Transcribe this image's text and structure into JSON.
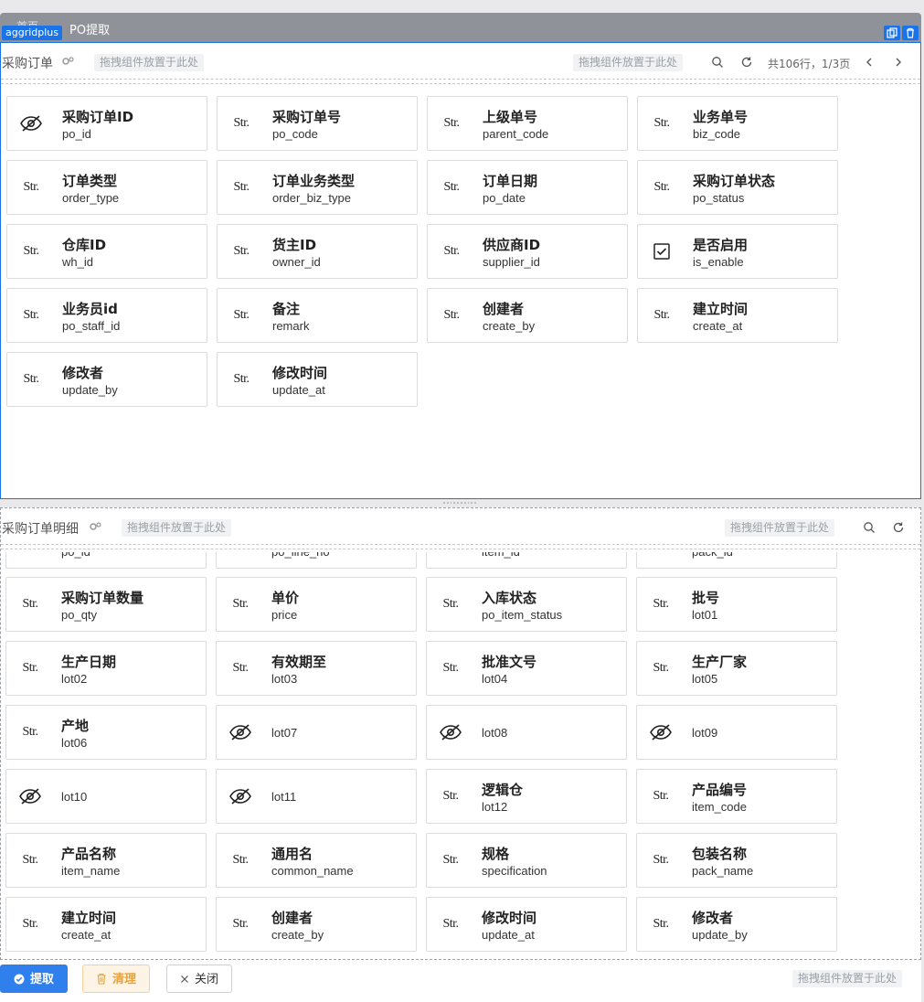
{
  "window": {
    "home_label": "首页",
    "title": "PO提取",
    "component_tag": "aggridplus",
    "copy_icon": "copy-icon",
    "delete_icon": "trash-icon"
  },
  "panel1": {
    "title": "采购订单",
    "drop_placeholder_left": "拖拽组件放置于此处",
    "drop_placeholder_right": "拖拽组件放置于此处",
    "pager_text": "共106行，1/3页",
    "cards": [
      {
        "icon": "eye-off",
        "cn": "采购订单ID",
        "en": "po_id"
      },
      {
        "icon": "str",
        "cn": "采购订单号",
        "en": "po_code"
      },
      {
        "icon": "str",
        "cn": "上级单号",
        "en": "parent_code"
      },
      {
        "icon": "str",
        "cn": "业务单号",
        "en": "biz_code"
      },
      {
        "icon": "str",
        "cn": "订单类型",
        "en": "order_type"
      },
      {
        "icon": "str",
        "cn": "订单业务类型",
        "en": "order_biz_type"
      },
      {
        "icon": "str",
        "cn": "订单日期",
        "en": "po_date"
      },
      {
        "icon": "str",
        "cn": "采购订单状态",
        "en": "po_status"
      },
      {
        "icon": "str",
        "cn": "仓库ID",
        "en": "wh_id"
      },
      {
        "icon": "str",
        "cn": "货主ID",
        "en": "owner_id"
      },
      {
        "icon": "str",
        "cn": "供应商ID",
        "en": "supplier_id"
      },
      {
        "icon": "checkbox",
        "cn": "是否启用",
        "en": "is_enable"
      },
      {
        "icon": "str",
        "cn": "业务员id",
        "en": "po_staff_id"
      },
      {
        "icon": "str",
        "cn": "备注",
        "en": "remark"
      },
      {
        "icon": "str",
        "cn": "创建者",
        "en": "create_by"
      },
      {
        "icon": "str",
        "cn": "建立时间",
        "en": "create_at"
      },
      {
        "icon": "str",
        "cn": "修改者",
        "en": "update_by"
      },
      {
        "icon": "str",
        "cn": "修改时间",
        "en": "update_at"
      }
    ]
  },
  "panel2": {
    "title": "采购订单明细",
    "drop_placeholder_left": "拖拽组件放置于此处",
    "drop_placeholder_right": "拖拽组件放置于此处",
    "clipped_row": [
      "po_id",
      "po_line_no",
      "item_id",
      "pack_id"
    ],
    "cards": [
      {
        "icon": "str",
        "cn": "采购订单数量",
        "en": "po_qty"
      },
      {
        "icon": "str",
        "cn": "单价",
        "en": "price"
      },
      {
        "icon": "str",
        "cn": "入库状态",
        "en": "po_item_status"
      },
      {
        "icon": "str",
        "cn": "批号",
        "en": "lot01"
      },
      {
        "icon": "str",
        "cn": "生产日期",
        "en": "lot02"
      },
      {
        "icon": "str",
        "cn": "有效期至",
        "en": "lot03"
      },
      {
        "icon": "str",
        "cn": "批准文号",
        "en": "lot04"
      },
      {
        "icon": "str",
        "cn": "生产厂家",
        "en": "lot05"
      },
      {
        "icon": "str",
        "cn": "产地",
        "en": "lot06"
      },
      {
        "icon": "eye-off",
        "cn": "",
        "en": "lot07"
      },
      {
        "icon": "eye-off",
        "cn": "",
        "en": "lot08"
      },
      {
        "icon": "eye-off",
        "cn": "",
        "en": "lot09"
      },
      {
        "icon": "eye-off",
        "cn": "",
        "en": "lot10"
      },
      {
        "icon": "eye-off",
        "cn": "",
        "en": "lot11"
      },
      {
        "icon": "str",
        "cn": "逻辑仓",
        "en": "lot12"
      },
      {
        "icon": "str",
        "cn": "产品编号",
        "en": "item_code"
      },
      {
        "icon": "str",
        "cn": "产品名称",
        "en": "item_name"
      },
      {
        "icon": "str",
        "cn": "通用名",
        "en": "common_name"
      },
      {
        "icon": "str",
        "cn": "规格",
        "en": "specification"
      },
      {
        "icon": "str",
        "cn": "包装名称",
        "en": "pack_name"
      },
      {
        "icon": "str",
        "cn": "建立时间",
        "en": "create_at"
      },
      {
        "icon": "str",
        "cn": "创建者",
        "en": "create_by"
      },
      {
        "icon": "str",
        "cn": "修改时间",
        "en": "update_at"
      },
      {
        "icon": "str",
        "cn": "修改者",
        "en": "update_by"
      }
    ]
  },
  "str_icon_text": "Str.",
  "footer": {
    "extract_label": "提取",
    "clear_label": "清理",
    "close_label": "关闭",
    "drop_placeholder": "拖拽组件放置于此处"
  },
  "colors": {
    "accent": "#1a73e8",
    "primary_button": "#2f80ed",
    "warn_text": "#e8a33a",
    "title_bar": "#8f9299"
  }
}
